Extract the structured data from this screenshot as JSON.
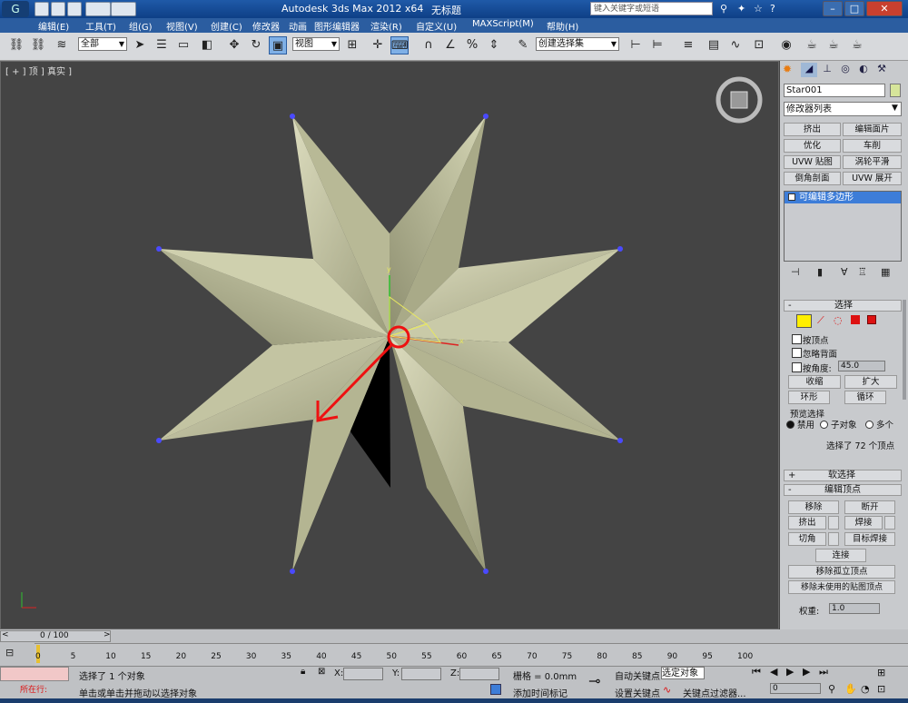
{
  "window": {
    "app_title": "Autodesk 3ds Max  2012 x64",
    "doc_title": "无标题",
    "search_placeholder": "键入关键字或短语"
  },
  "menu": [
    "编辑(E)",
    "工具(T)",
    "组(G)",
    "视图(V)",
    "创建(C)",
    "修改器",
    "动画",
    "图形编辑器",
    "渲染(R)",
    "自定义(U)",
    "MAXScript(M)",
    "帮助(H)"
  ],
  "toolbar": {
    "selection_filter": "全部",
    "reference_coord": "视图",
    "named_selection": "创建选择集",
    "percent_snap": "%"
  },
  "viewport": {
    "label": "[ + ] 顶 ] 真实 ]",
    "axis_y": "y",
    "axis_x": "x"
  },
  "cmdpanel": {
    "object_name": "Star001",
    "modifier_list": "修改器列表",
    "mod_buttons": [
      "挤出",
      "编辑面片",
      "优化",
      "车削",
      "UVW 贴图",
      "涡轮平滑",
      "倒角剖面",
      "UVW 展开"
    ],
    "stack_item": "可编辑多边形",
    "selection": {
      "title": "选择",
      "by_vertex": "按顶点",
      "ignore_backface": "忽略背面",
      "by_angle": "按角度:",
      "angle_value": "45.0",
      "shrink": "收缩",
      "grow": "扩大",
      "ring": "环形",
      "loop": "循环",
      "preview_title": "预览选择",
      "preview_opts": [
        "禁用",
        "子对象",
        "多个"
      ],
      "status": "选择了 72 个顶点"
    },
    "soft_selection": "软选择",
    "edit_vertices": {
      "title": "编辑顶点",
      "remove": "移除",
      "break": "断开",
      "extrude": "挤出",
      "weld": "焊接",
      "chamfer": "切角",
      "target_weld": "目标焊接",
      "connect": "连接",
      "remove_isolated": "移除孤立顶点",
      "remove_unused": "移除未使用的贴图顶点",
      "weight_label": "权重:",
      "weight_value": "1.0"
    }
  },
  "timeline": {
    "frame_counter": "0 / 100",
    "ticks": [
      "0",
      "5",
      "10",
      "15",
      "20",
      "25",
      "30",
      "35",
      "40",
      "45",
      "50",
      "55",
      "60",
      "65",
      "70",
      "75",
      "80",
      "85",
      "90",
      "95",
      "100"
    ]
  },
  "status": {
    "running": "所在行:",
    "line1": "选择了 1 个对象",
    "line2": "单击或单击并拖动以选择对象",
    "x_label": "X:",
    "y_label": "Y:",
    "z_label": "Z:",
    "grid": "栅格 = 0.0mm",
    "add_time_tag": "添加时间标记",
    "auto_key": "自动关键点",
    "selected_object": "选定对象",
    "set_key": "设置关键点",
    "key_filters": "关键点过滤器...",
    "frame_value": "0"
  },
  "colors": {
    "title_bar": "#1f5aa8",
    "viewport_bg": "#444444",
    "star_face": "#c5c6a4",
    "vertex": "#4040ff",
    "arrow": "#ee1111"
  }
}
